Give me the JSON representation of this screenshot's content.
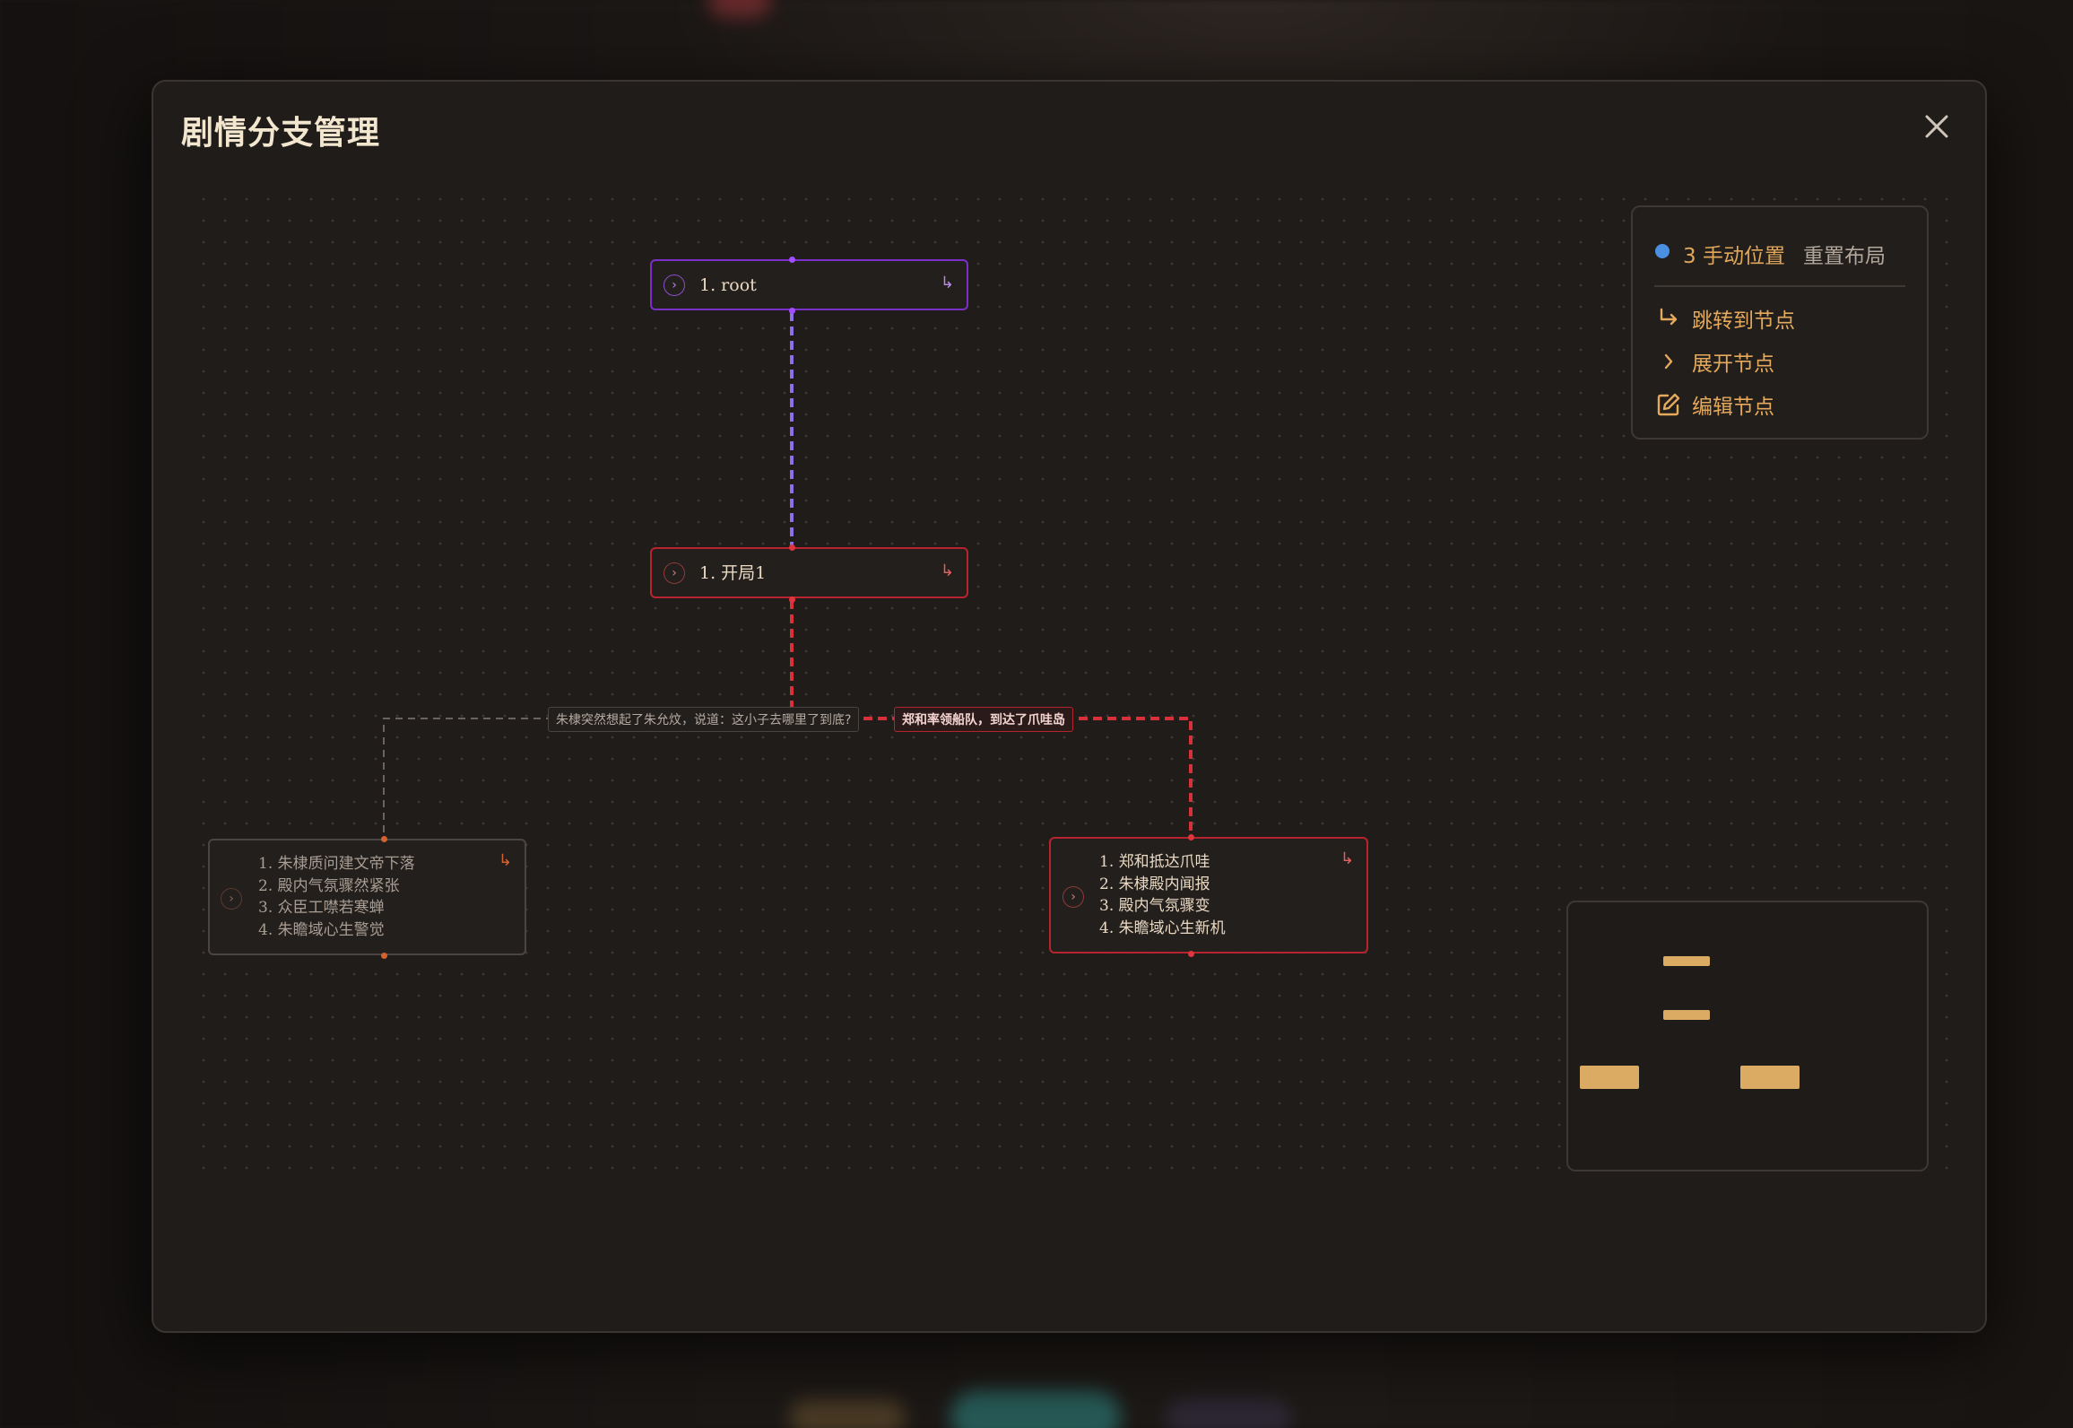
{
  "modal": {
    "title": "剧情分支管理",
    "close_icon": "close-icon"
  },
  "graph": {
    "nodes": {
      "root": {
        "label": "1. root"
      },
      "opening": {
        "label": "1. 开局1"
      },
      "branch_left": {
        "items": [
          "1. 朱棣质问建文帝下落",
          "2. 殿内气氛骤然紧张",
          "3. 众臣工噤若寒蝉",
          "4. 朱瞻域心生警觉"
        ]
      },
      "branch_right": {
        "items": [
          "1. 郑和抵达爪哇",
          "2. 朱棣殿内闻报",
          "3. 殿内气氛骤变",
          "4. 朱瞻域心生新机"
        ]
      }
    },
    "edges": {
      "left_label": "朱棣突然想起了朱允炆，说道：这小子去哪里了到底?",
      "right_label": "郑和率领船队，到达了爪哇岛"
    },
    "colors": {
      "root_border": "#7b2fc9",
      "active_red": "#d7303a",
      "inactive_gray": "#6a6360",
      "accent_orange": "#e0a75a",
      "manual_dot": "#4a90e2"
    }
  },
  "legend": {
    "manual_positions": "3 手动位置",
    "reset_layout": "重置布局",
    "items": [
      {
        "icon": "jump-arrow-icon",
        "label": "跳转到节点"
      },
      {
        "icon": "chevron-right-icon",
        "label": "展开节点"
      },
      {
        "icon": "edit-icon",
        "label": "编辑节点"
      }
    ]
  }
}
